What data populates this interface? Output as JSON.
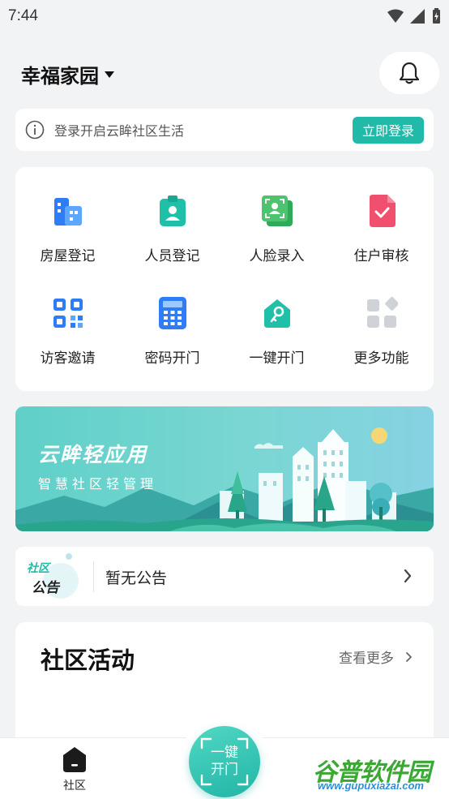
{
  "status_bar": {
    "time": "7:44"
  },
  "header": {
    "community_name": "幸福家园"
  },
  "login_bar": {
    "text": "登录开启云眸社区生活",
    "button": "立即登录"
  },
  "features": [
    {
      "label": "房屋登记",
      "icon": "building-icon"
    },
    {
      "label": "人员登记",
      "icon": "person-badge-icon"
    },
    {
      "label": "人脸录入",
      "icon": "face-scan-icon"
    },
    {
      "label": "住户审核",
      "icon": "check-document-icon"
    },
    {
      "label": "访客邀请",
      "icon": "qr-code-icon"
    },
    {
      "label": "密码开门",
      "icon": "keypad-icon"
    },
    {
      "label": "一键开门",
      "icon": "home-key-icon"
    },
    {
      "label": "更多功能",
      "icon": "more-grid-icon"
    }
  ],
  "banner": {
    "title": "云眸轻应用",
    "subtitle": "智慧社区轻管理"
  },
  "notice": {
    "badge_line1": "社区",
    "badge_line2": "公告",
    "text": "暂无公告"
  },
  "activity": {
    "title": "社区活动",
    "more": "查看更多"
  },
  "tabbar": {
    "home_label": "社区",
    "open_door_label": "一键开门"
  },
  "watermark": {
    "main": "谷普软件园",
    "url": "www.gupuxiazai.com"
  },
  "colors": {
    "accent": "#21b9a7",
    "background": "#f2f3f5"
  }
}
